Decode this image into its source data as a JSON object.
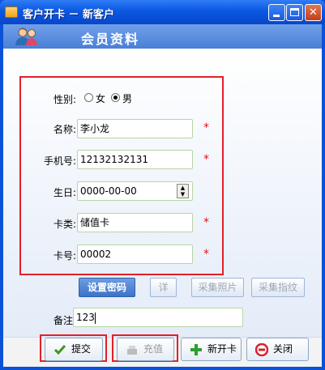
{
  "window": {
    "title": "客户开卡 － 新客户"
  },
  "header": {
    "title": "会员资料"
  },
  "form": {
    "gender": {
      "label": "性别:",
      "options": [
        "女",
        "男"
      ],
      "selected": "男"
    },
    "name": {
      "label": "名称:",
      "value": "李小龙"
    },
    "phone": {
      "label": "手机号:",
      "value": "12132132131"
    },
    "birthday": {
      "label": "生日:",
      "value": "0000-00-00"
    },
    "card_type": {
      "label": "卡类:",
      "value": "储值卡"
    },
    "card_no": {
      "label": "卡号:",
      "value": "00002"
    },
    "required_mark": "*",
    "note": {
      "label": "备注:",
      "value": "123"
    }
  },
  "tools": {
    "set_password": "设置密码",
    "detail": "详",
    "capture_photo": "采集照片",
    "capture_fingerprint": "采集指纹"
  },
  "actions": {
    "submit": "提交",
    "recharge": "充值",
    "new_card": "新开卡",
    "close": "关闭"
  },
  "colors": {
    "titlebar": "#0b58e2",
    "highlight": "#e3202a",
    "required": "#e0101a",
    "header": "#4a7fd8"
  }
}
